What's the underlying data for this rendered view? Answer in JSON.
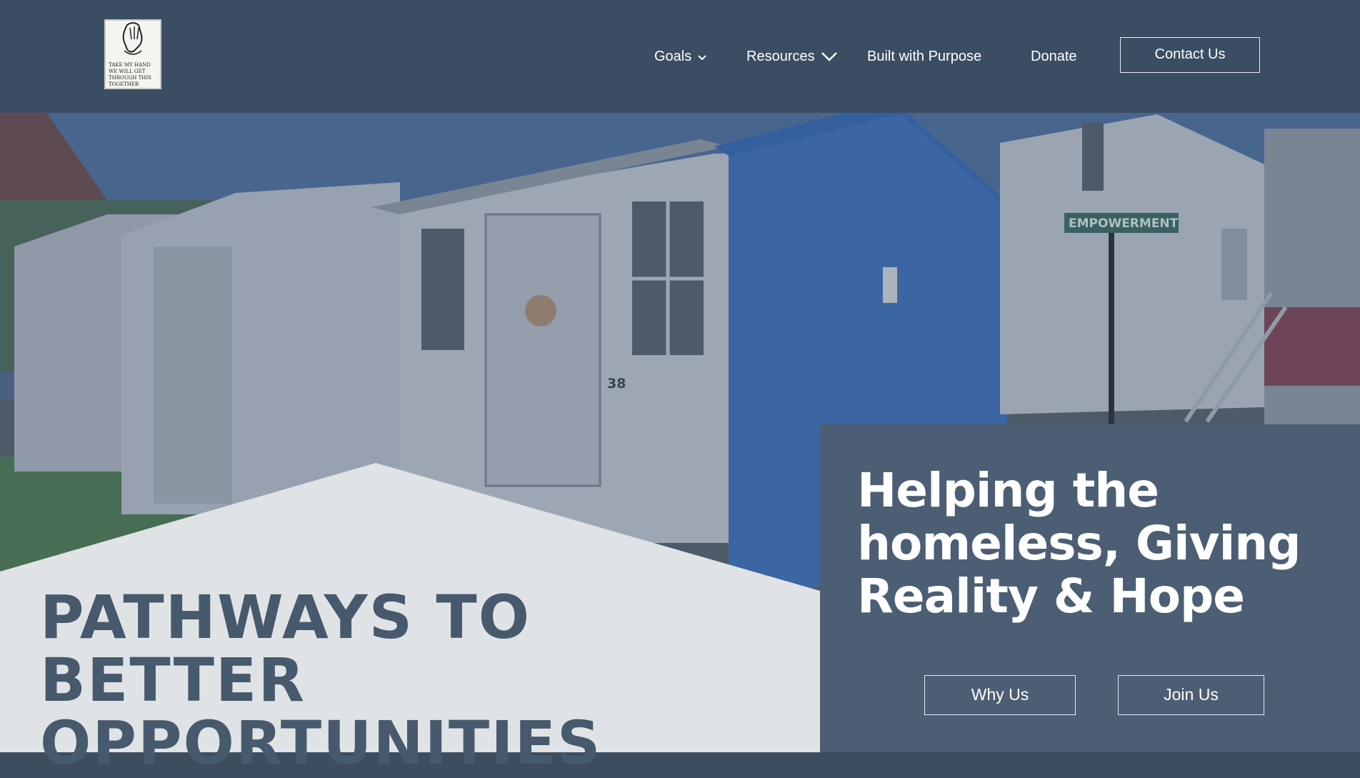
{
  "logo": {
    "icon": "hand-sketch-logo",
    "lettering": "TAKE MY HAND WE WILL GET THROUGH THIS TOGETHER"
  },
  "nav": {
    "goals": "Goals",
    "resources": "Resources",
    "built": "Built with Purpose",
    "donate": "Donate",
    "contact": "Contact Us"
  },
  "hero": {
    "sign_text": "EMPOWERMENT",
    "door_number": "38"
  },
  "pathways_title": "PATHWAYS TO BETTER OPPORTUNITIES",
  "info": {
    "heading": "Helping the homeless, Giving Reality & Hope",
    "why_us": "Why Us",
    "join_us": "Join Us"
  },
  "colors": {
    "header": "#3a4b60",
    "panel": "#4c5e73",
    "light_panel": "#e0e3e6",
    "title_text": "#47596d",
    "shed_blue": "#3f6fb6"
  }
}
